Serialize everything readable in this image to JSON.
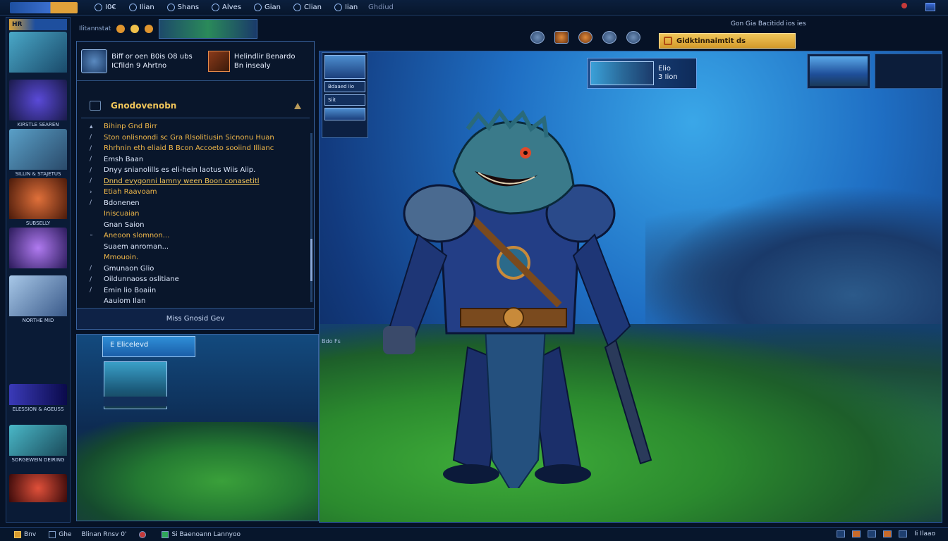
{
  "topbar": {
    "menu": [
      {
        "label": "I0€",
        "icon": "home-icon"
      },
      {
        "label": "Ilian",
        "icon": "map-icon"
      },
      {
        "label": "Shans",
        "icon": "sword-icon"
      },
      {
        "label": "Alves",
        "icon": "globe-icon"
      },
      {
        "label": "Gian",
        "icon": "bag-icon"
      },
      {
        "label": "Clian",
        "icon": "scroll-icon"
      },
      {
        "label": "Iian",
        "icon": "user-icon"
      }
    ],
    "status": "Ghdiud"
  },
  "left_rail": {
    "header": "HR",
    "thumbnails": [
      {
        "caption": "",
        "colors": [
          "#4aa8c8",
          "#1a4a6a"
        ]
      },
      {
        "caption": "KIRSTLE SEAREN",
        "colors": [
          "#3a2a9a",
          "#1a1a4a"
        ]
      },
      {
        "caption": "SILLIN & STAJETUS",
        "colors": [
          "#5aa0c8",
          "#2a4a6a"
        ]
      },
      {
        "caption": "SUBSELLY",
        "colors": [
          "#c8582a",
          "#4a1a0a"
        ]
      },
      {
        "caption": "",
        "colors": [
          "#8a5ad8",
          "#2a1a5a"
        ]
      },
      {
        "caption": "NORTHE MID",
        "colors": [
          "#a8c8e8",
          "#3a5a8a"
        ]
      },
      {
        "caption": "ELESSION & AGEUSS",
        "colors": [
          "#3a3ab8",
          "#0a0a4a"
        ]
      },
      {
        "caption": "SORGEWEIN DEIRING",
        "colors": [
          "#4ab8c8",
          "#1a4a5a"
        ]
      },
      {
        "caption": "",
        "colors": [
          "#c83a2a",
          "#3a0a0a"
        ]
      }
    ]
  },
  "strip": {
    "label": "Ilitannstat"
  },
  "dialog": {
    "header_left": {
      "line1": "Biff or oen B0is O8 ubs",
      "line2": "ICfildn 9 Ahrtno"
    },
    "header_right": {
      "line1": "Helindlir Benardo",
      "line2": "Bn insealy"
    },
    "section_title": "Gnodovenobn",
    "lines": [
      {
        "text": "Bihinp Gnd Birr",
        "style": "gold"
      },
      {
        "text": "Ston onlisnondi sc Gra Rlsolitiusin Sicnonu Huan",
        "style": "gold"
      },
      {
        "text": "Rhrhnin eth eliaid B Bcon Accoeto sooiind Illianc",
        "style": "gold"
      },
      {
        "text": "Emsh Baan",
        "style": ""
      },
      {
        "text": "Dnyy snianolills es eli-hein laotus Wiis Aiip.",
        "style": ""
      },
      {
        "text": "Dnnd evygonni lamny ween Boon conasetitl",
        "style": "hl"
      },
      {
        "text": "Etiah Raavoam",
        "style": "gold"
      },
      {
        "text": "Bdonenen",
        "style": ""
      },
      {
        "text": "Iniscuaian",
        "style": "gold"
      },
      {
        "text": "Gnan Saion",
        "style": ""
      },
      {
        "text": "Aneoon slomnon...",
        "style": "gold"
      },
      {
        "text": "Suaem anroman...",
        "style": ""
      },
      {
        "text": "Mmouoin.",
        "style": "gold"
      },
      {
        "text": "Gmunaon Glio",
        "style": ""
      },
      {
        "text": "Oildunnaoss oslitiane",
        "style": ""
      },
      {
        "text": "Emin lio Boaiin",
        "style": ""
      },
      {
        "text": "Aauiom Ilan",
        "style": ""
      }
    ],
    "footer": "Miss Gnosid Gev"
  },
  "lower_panel": {
    "tab": "E  Elicelevd"
  },
  "scene": {
    "quest_bar": "Gidktinnaimtit ds",
    "info_line": "Gon Gia  Bacitidd ios ies",
    "card_a": {
      "line1": "Elio",
      "line2": "3 Iion"
    },
    "thumb_labels": [
      "Bdaaed iio",
      "Siit"
    ],
    "scene_label": "Bdo Fs"
  },
  "bottom": {
    "items": [
      {
        "label": "Bnv",
        "icon": "gold"
      },
      {
        "label": "Ghe",
        "icon": ""
      },
      {
        "label": "Blinan Rnsv 0'",
        "icon": ""
      },
      {
        "label": "",
        "icon": "red"
      },
      {
        "label": "Si Baenoann Lannyoo",
        "icon": "green"
      }
    ],
    "right_label": "Ii Ilaao"
  }
}
